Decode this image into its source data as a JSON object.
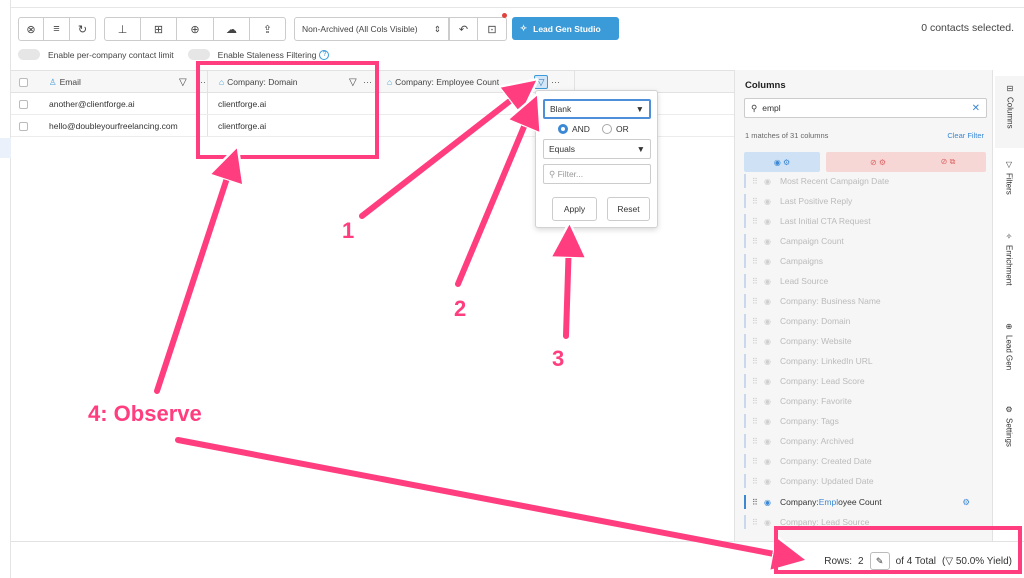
{
  "toolbar": {
    "view_select": "Non-Archived (All Cols Visible)",
    "studio_label": "Lead Gen Studio",
    "contacts_selected": "0 contacts selected."
  },
  "toggles": {
    "company_limit": "Enable per-company contact limit",
    "staleness": "Enable Staleness Filtering"
  },
  "grid": {
    "columns": [
      "Email",
      "Company: Domain",
      "Company: Employee Count"
    ],
    "rows": [
      {
        "email": "another@clientforge.ai",
        "domain": "clientforge.ai"
      },
      {
        "email": "hello@doubleyourfreelancing.com",
        "domain": "clientforge.ai"
      }
    ]
  },
  "filter_popup": {
    "condition": "Blank",
    "and_label": "AND",
    "or_label": "OR",
    "operator": "Equals",
    "filter_placeholder": "Filter...",
    "apply_label": "Apply",
    "reset_label": "Reset"
  },
  "columns_panel": {
    "title": "Columns",
    "search_value": "empl",
    "matches": "1 matches of 31 columns",
    "clear_filter": "Clear Filter",
    "items": [
      "Most Recent Campaign Date",
      "Last Positive Reply",
      "Last Initial CTA Request",
      "Campaign Count",
      "Campaigns",
      "Lead Source",
      "Company: Business Name",
      "Company: Domain",
      "Company: Website",
      "Company: LinkedIn URL",
      "Company: Lead Score",
      "Company: Favorite",
      "Company: Tags",
      "Company: Archived",
      "Company: Created Date",
      "Company: Updated Date"
    ],
    "active_item_prefix": "Company: ",
    "active_item_highlight": "Empl",
    "active_item_suffix": "oyee Count",
    "last_item": "Company: Lead Source"
  },
  "right_tabs": [
    "Columns",
    "Filters",
    "Enrichment",
    "Lead Gen",
    "Settings"
  ],
  "footer": {
    "rows_label": "Rows:",
    "rows_value": "2",
    "of_total": "of 4 Total",
    "yield": "50.0% Yield)"
  },
  "annotations": {
    "a1": "1",
    "a2": "2",
    "a3": "3",
    "a4": "4: Observe"
  },
  "colors": {
    "accent": "#3b9ad8",
    "annotation": "#ff3d7f"
  }
}
